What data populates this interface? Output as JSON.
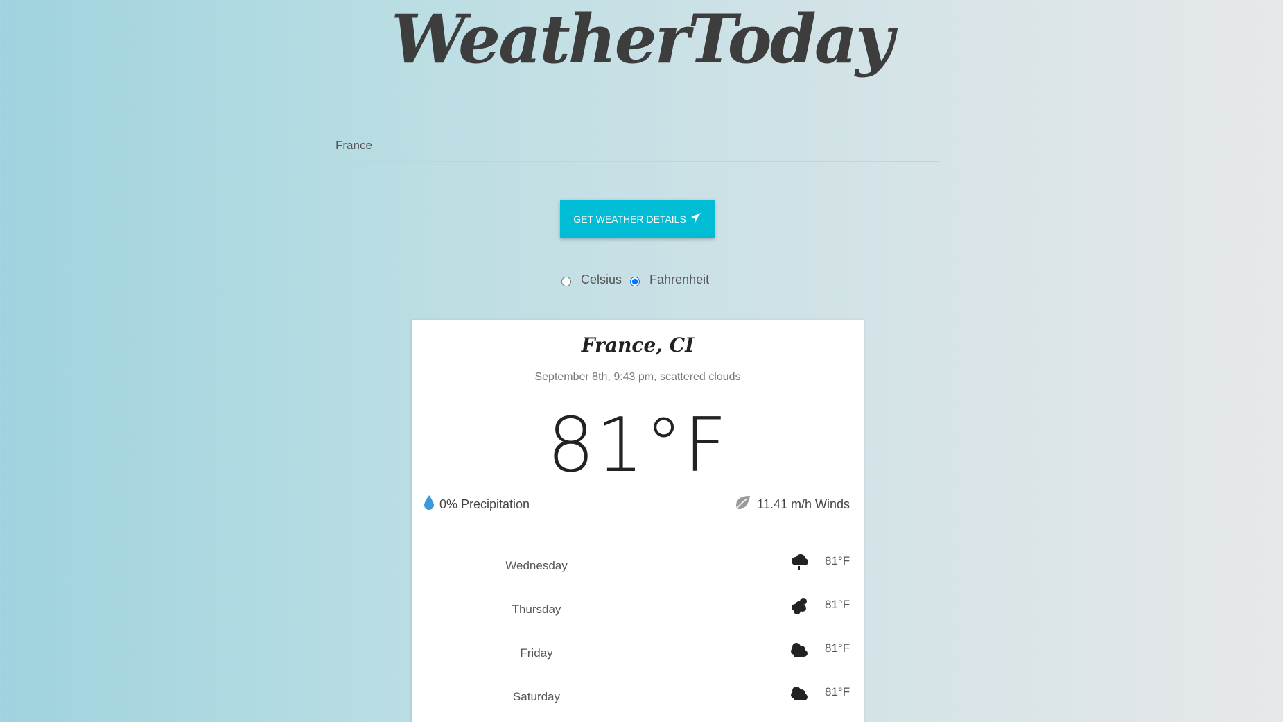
{
  "app": {
    "title": "WeatherToday"
  },
  "search": {
    "value": "France",
    "placeholder": ""
  },
  "button": {
    "label": "GET WEATHER DETAILS"
  },
  "units": {
    "celsius_label": "Celsius",
    "fahrenheit_label": "Fahrenheit",
    "selected": "Fahrenheit"
  },
  "current": {
    "location": "France, CI",
    "description": "September 8th, 9:43 pm, scattered clouds",
    "temperature": "81°F",
    "precipitation": "0% Precipitation",
    "winds": "11.41 m/h Winds"
  },
  "forecast": [
    {
      "day": "Wednesday",
      "temp": "81°F",
      "icon": "rain-cloud-icon"
    },
    {
      "day": "Thursday",
      "temp": "81°F",
      "icon": "partly-cloudy-icon"
    },
    {
      "day": "Friday",
      "temp": "81°F",
      "icon": "clouds-icon"
    },
    {
      "day": "Saturday",
      "temp": "81°F",
      "icon": "clouds-icon"
    }
  ],
  "colors": {
    "accent": "#00bcd4",
    "raindrop": "#3a9ad9"
  }
}
